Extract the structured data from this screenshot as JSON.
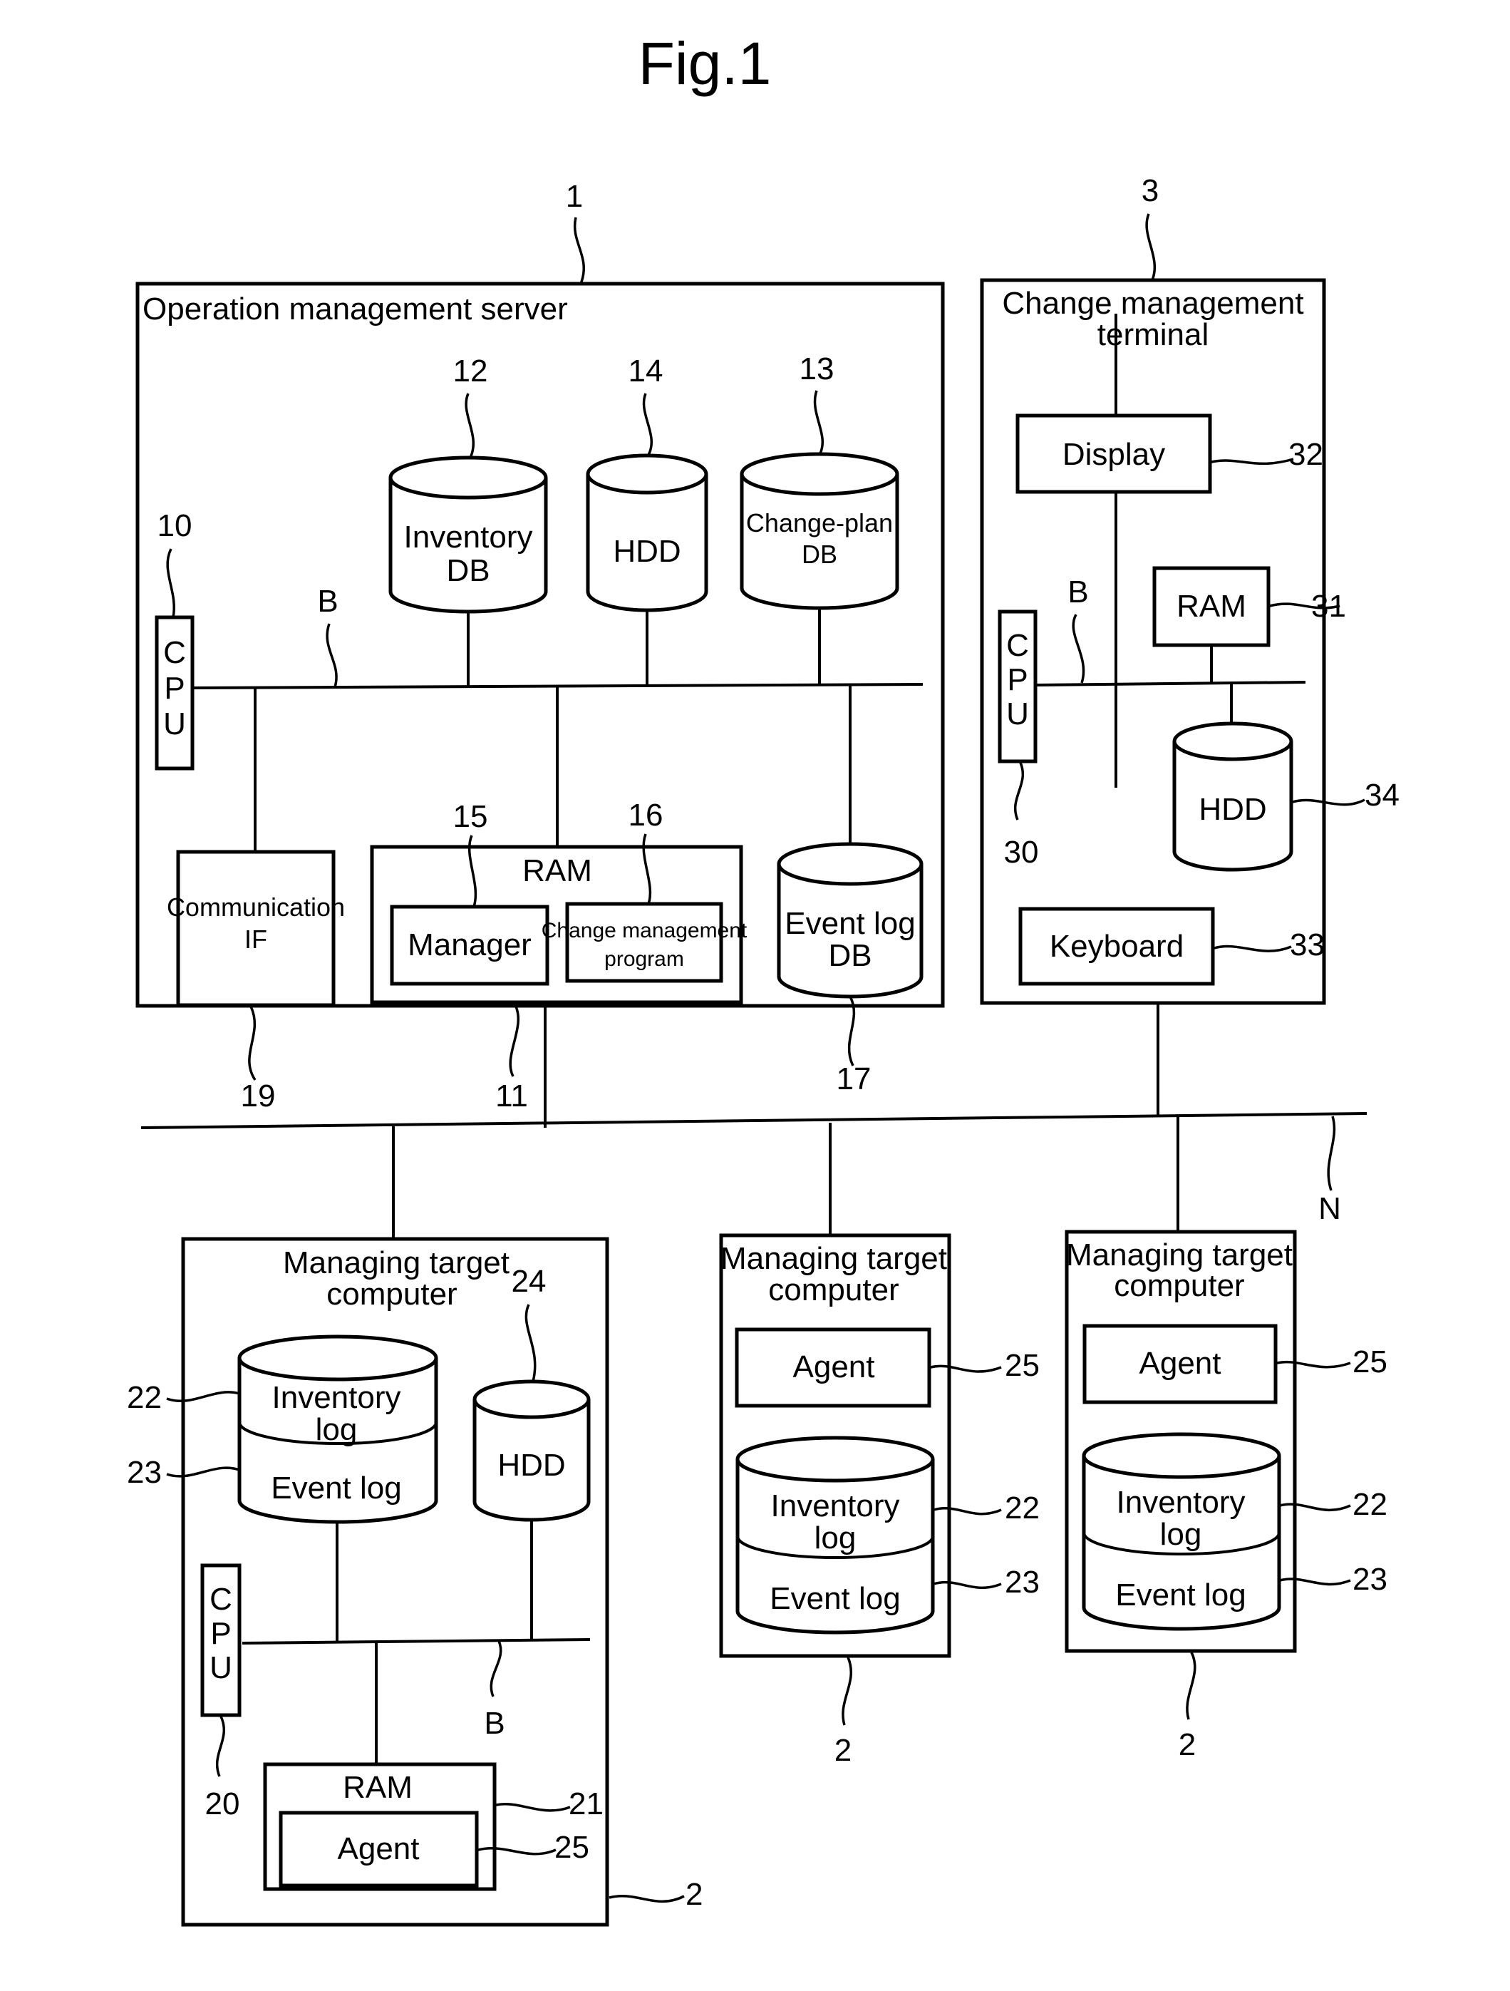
{
  "figure": {
    "title": "Fig.1",
    "network_label": "N"
  },
  "server": {
    "ref": "1",
    "title": "Operation management server",
    "cpu": {
      "ref": "10",
      "label": [
        "C",
        "P",
        "U"
      ]
    },
    "bus_label": "B",
    "inventory_db": {
      "ref": "12",
      "label": [
        "Inventory",
        "DB"
      ]
    },
    "hdd": {
      "ref": "14",
      "label": [
        "HDD"
      ]
    },
    "change_plan_db": {
      "ref": "13",
      "label": [
        "Change-plan",
        "DB"
      ]
    },
    "comm_if": {
      "ref": "19",
      "label": [
        "Communication",
        "IF"
      ]
    },
    "ram": {
      "ref": "11",
      "label": "RAM"
    },
    "manager": {
      "ref": "15",
      "label": "Manager"
    },
    "change_program": {
      "ref": "16",
      "label": [
        "Change management",
        "program"
      ]
    },
    "event_log_db": {
      "ref": "17",
      "label": [
        "Event log",
        "DB"
      ]
    }
  },
  "terminal": {
    "ref": "3",
    "title": [
      "Change management",
      "terminal"
    ],
    "display": {
      "ref": "32",
      "label": "Display"
    },
    "ram": {
      "ref": "31",
      "label": "RAM"
    },
    "cpu": {
      "ref": "30",
      "label": [
        "C",
        "P",
        "U"
      ]
    },
    "bus_label": "B",
    "hdd": {
      "ref": "34",
      "label": "HDD"
    },
    "keyboard": {
      "ref": "33",
      "label": "Keyboard"
    }
  },
  "targets": [
    {
      "ref": "2",
      "title": [
        "Managing target",
        "computer"
      ],
      "inventory_log": {
        "ref": "22",
        "label": [
          "Inventory",
          "log"
        ]
      },
      "event_log": {
        "ref": "23",
        "label": "Event log"
      },
      "hdd": {
        "ref": "24",
        "label": "HDD"
      },
      "cpu": {
        "ref": "20",
        "label": [
          "C",
          "P",
          "U"
        ]
      },
      "bus_label": "B",
      "ram": {
        "ref": "21",
        "label": "RAM"
      },
      "agent": {
        "ref": "25",
        "label": "Agent"
      }
    },
    {
      "ref": "2",
      "title": [
        "Managing target",
        "computer"
      ],
      "agent": {
        "ref": "25",
        "label": "Agent"
      },
      "inventory_log": {
        "ref": "22",
        "label": [
          "Inventory",
          "log"
        ]
      },
      "event_log": {
        "ref": "23",
        "label": "Event log"
      }
    },
    {
      "ref": "2",
      "title": [
        "Managing target",
        "computer"
      ],
      "agent": {
        "ref": "25",
        "label": "Agent"
      },
      "inventory_log": {
        "ref": "22",
        "label": [
          "Inventory",
          "log"
        ]
      },
      "event_log": {
        "ref": "23",
        "label": "Event log"
      }
    }
  ]
}
